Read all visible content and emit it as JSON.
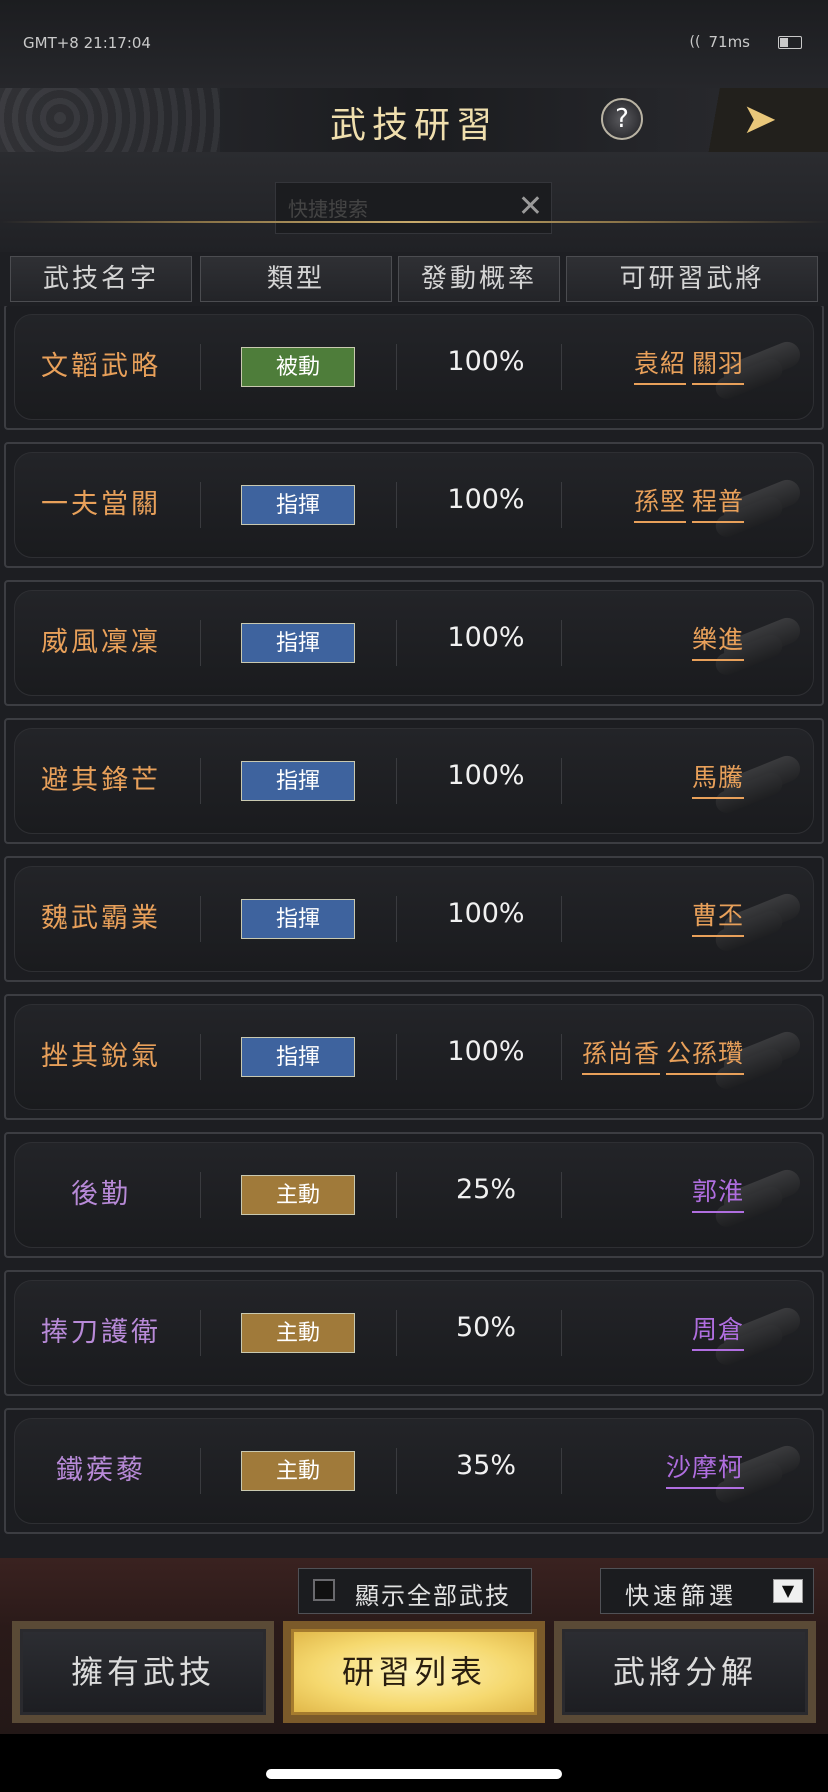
{
  "status_bar": {
    "time": "GMT+8 21:17:04",
    "ping": "71ms"
  },
  "header": {
    "title": "武技研習",
    "help_label": "?"
  },
  "search": {
    "placeholder": "快捷搜索",
    "value": "",
    "clear_label": "✕"
  },
  "columns": [
    "武技名字",
    "類型",
    "發動概率",
    "可研習武將"
  ],
  "rows": [
    {
      "name": "文韜武略",
      "type": "被動",
      "rate": "100%",
      "generals": [
        "袁紹",
        "關羽"
      ],
      "name_color": "#e8a05a",
      "gen_color": "#e8a05a",
      "type_color": "#4e7d3a"
    },
    {
      "name": "一夫當關",
      "type": "指揮",
      "rate": "100%",
      "generals": [
        "孫堅",
        "程普"
      ],
      "name_color": "#e8a05a",
      "gen_color": "#e8a05a",
      "type_color": "#3e639e"
    },
    {
      "name": "威風凜凜",
      "type": "指揮",
      "rate": "100%",
      "generals": [
        "樂進"
      ],
      "name_color": "#e8a05a",
      "gen_color": "#e8a05a",
      "type_color": "#3e639e"
    },
    {
      "name": "避其鋒芒",
      "type": "指揮",
      "rate": "100%",
      "generals": [
        "馬騰"
      ],
      "name_color": "#e8a05a",
      "gen_color": "#e8a05a",
      "type_color": "#3e639e"
    },
    {
      "name": "魏武霸業",
      "type": "指揮",
      "rate": "100%",
      "generals": [
        "曹丕"
      ],
      "name_color": "#e8a05a",
      "gen_color": "#e8a05a",
      "type_color": "#3e639e"
    },
    {
      "name": "挫其銳氣",
      "type": "指揮",
      "rate": "100%",
      "generals": [
        "孫尚香",
        "公孫瓚"
      ],
      "name_color": "#e8a05a",
      "gen_color": "#e8a05a",
      "type_color": "#3e639e"
    },
    {
      "name": "後勤",
      "type": "主動",
      "rate": "25%",
      "generals": [
        "郭淮"
      ],
      "name_color": "#b88ad8",
      "gen_color": "#b06ee0",
      "type_color": "#a07a3a"
    },
    {
      "name": "捧刀護衛",
      "type": "主動",
      "rate": "50%",
      "generals": [
        "周倉"
      ],
      "name_color": "#b88ad8",
      "gen_color": "#b06ee0",
      "type_color": "#a07a3a"
    },
    {
      "name": "鐵蒺藜",
      "type": "主動",
      "rate": "35%",
      "generals": [
        "沙摩柯"
      ],
      "name_color": "#b88ad8",
      "gen_color": "#b06ee0",
      "type_color": "#a07a3a"
    }
  ],
  "footer": {
    "show_all_label": "顯示全部武技",
    "show_all_checked": false,
    "filter_label": "快速篩選",
    "tabs": [
      {
        "label": "擁有武技",
        "active": false
      },
      {
        "label": "研習列表",
        "active": true
      },
      {
        "label": "武將分解",
        "active": false
      }
    ]
  }
}
